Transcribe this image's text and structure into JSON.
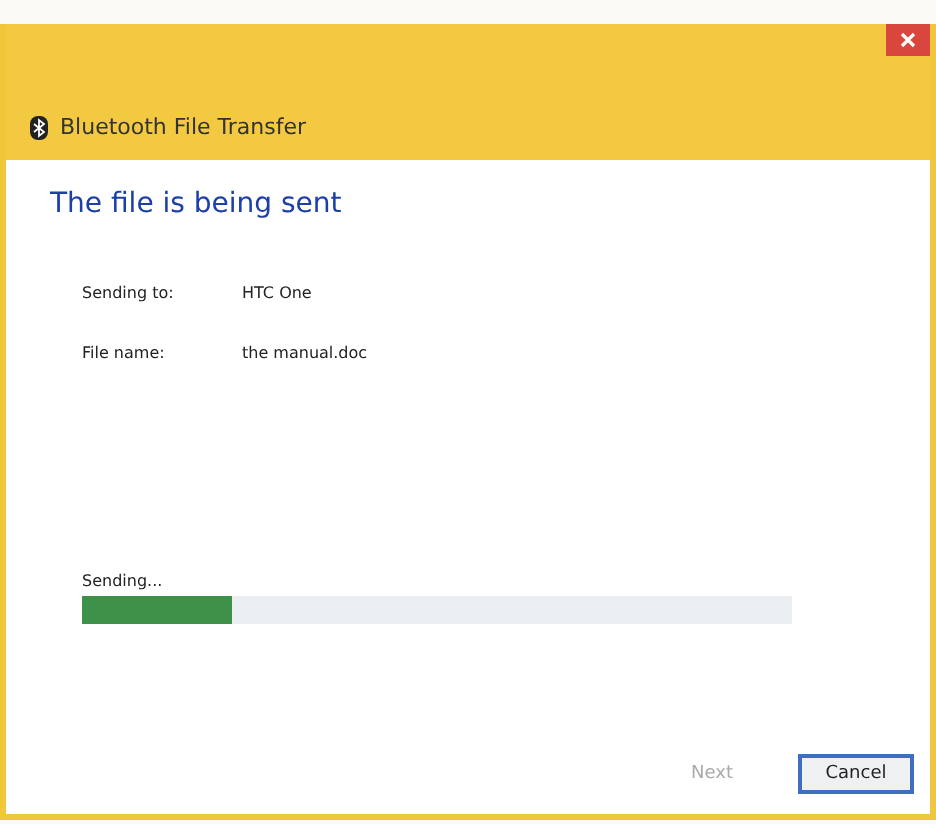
{
  "window": {
    "title": "Bluetooth File Transfer"
  },
  "heading": "The file is being sent",
  "details": [
    {
      "label": "Sending to:",
      "value": "HTC One"
    },
    {
      "label": "File name:",
      "value": "the manual.doc"
    }
  ],
  "progress": {
    "label": "Sending...",
    "level": 0.21
  },
  "buttons": [
    {
      "label": "Next",
      "disabled": true,
      "default": false
    },
    {
      "label": "Cancel",
      "disabled": false,
      "default": true
    }
  ]
}
